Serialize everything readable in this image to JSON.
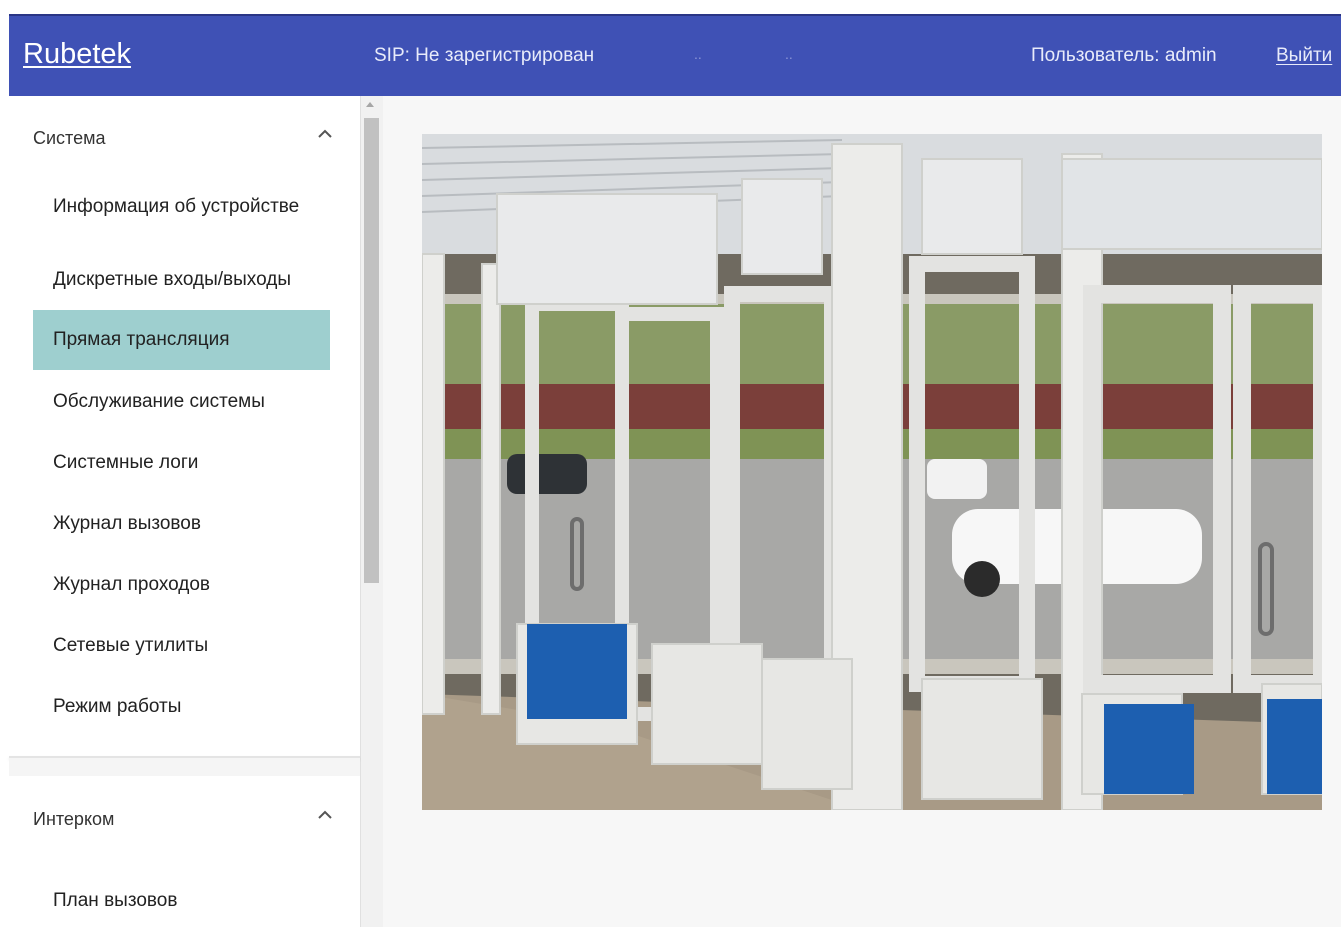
{
  "header": {
    "logo": "Rubetek",
    "sip_status": "SIP: Не зарегистрирован",
    "dots_1": "..",
    "dots_2": "..",
    "user": "Пользователь: admin",
    "logout": "Выйти"
  },
  "sidebar": {
    "system": {
      "title": "Система",
      "items": [
        "Информация об устройстве",
        "Дискретные входы/выходы",
        "Прямая трансляция",
        "Обслуживание системы",
        "Системные логи",
        "Журнал вызовов",
        "Журнал проходов",
        "Сетевые утилиты",
        "Режим работы"
      ],
      "active_index": 2
    },
    "intercom": {
      "title": "Интерком",
      "items": [
        "План вызовов"
      ]
    }
  },
  "colors": {
    "header_bg": "#3f51b5",
    "active_item_bg": "#9ecfcf"
  },
  "icons": {
    "section_toggle": "chevron-up-icon",
    "scroll": "arrow-up-icon"
  },
  "main": {
    "live_video": "camera-feed"
  }
}
